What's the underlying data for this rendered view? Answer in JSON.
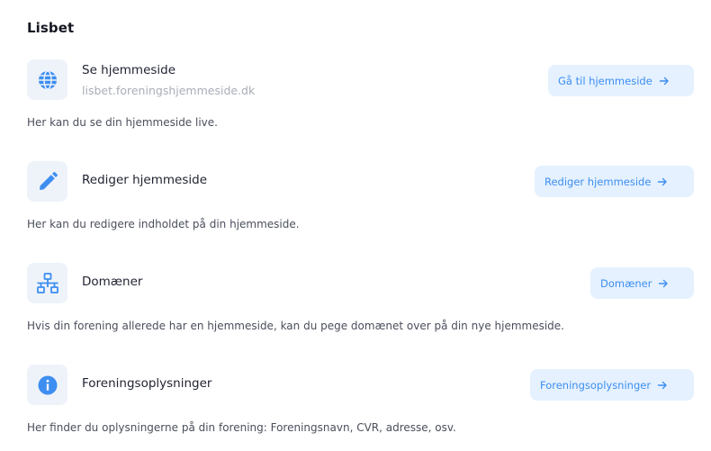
{
  "page": {
    "title": "Lisbet"
  },
  "sections": [
    {
      "title": "Se hjemmeside",
      "subtitle": "lisbet.foreningshjemmeside.dk",
      "button_label": "Gå til hjemmeside",
      "description": "Her kan du se din hjemmeside live.",
      "icon": "globe-icon"
    },
    {
      "title": "Rediger hjemmeside",
      "button_label": "Rediger hjemmeside",
      "description": "Her kan du redigere indholdet på din hjemmeside.",
      "icon": "pencil-icon"
    },
    {
      "title": "Domæner",
      "button_label": "Domæner",
      "description": "Hvis din forening allerede har en hjemmeside, kan du pege domænet over på din nye hjemmeside.",
      "icon": "network-icon"
    },
    {
      "title": "Foreningsoplysninger",
      "button_label": "Foreningsoplysninger",
      "description": "Her finder du oplysningerne på din forening: Foreningsnavn, CVR, adresse, osv.",
      "icon": "info-icon"
    }
  ],
  "colors": {
    "accent": "#3d8ef0",
    "button_bg": "#e5f1ff",
    "icon_bg": "#eef3fa"
  }
}
